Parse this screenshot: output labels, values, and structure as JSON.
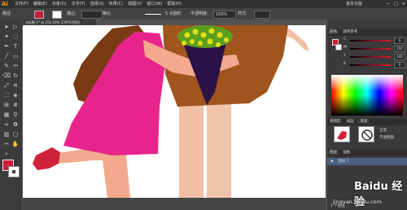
{
  "app": {
    "logo": "Ai"
  },
  "menubar": {
    "items": [
      "文件(F)",
      "编辑(E)",
      "对象(O)",
      "文字(T)",
      "选择(S)",
      "效果(C)",
      "视图(V)",
      "窗口(W)",
      "帮助(H)"
    ],
    "workspace": "基本功能",
    "window_controls": [
      "—",
      "□",
      "✕"
    ]
  },
  "controlbar": {
    "path_label": "路径",
    "stroke_label": "描边:",
    "stroke_value": "",
    "uniform_label": "等比",
    "brush_label": "5 点圆形",
    "opacity_label": "不透明度:",
    "opacity_value": "100%",
    "style_label": "样式:"
  },
  "document": {
    "tab_title": "未标题-1* @ 201.83% (CMYK/预览)"
  },
  "toolbar": {
    "tools": [
      "selection-arrow",
      "direct-select",
      "magic-wand",
      "lasso",
      "pen",
      "type",
      "line",
      "rectangle",
      "paintbrush",
      "pencil",
      "eraser",
      "rotate",
      "scale",
      "width",
      "free-transform",
      "shape-builder",
      "perspective",
      "mesh",
      "gradient",
      "eyedropper",
      "blend",
      "symbol-sprayer",
      "column-graph",
      "artboard",
      "slice",
      "hand",
      "zoom"
    ],
    "fill_color": "#d01f35",
    "stroke_color": "#ffffff"
  },
  "canvas": {
    "background": "#ffffff",
    "colors": {
      "dress": "#e8248c",
      "hair": "#7a3a14",
      "skin": "#f2a98d",
      "shirt": "#a0541e",
      "legs": "#f2bfa5",
      "shoe": "#d0203a",
      "cone": "#2a1246",
      "leaves": "#5c9e1f",
      "flowers": "#e0e01a"
    }
  },
  "panels": {
    "color_tabs": [
      "颜色",
      "颜色参考"
    ],
    "sliders": [
      {
        "label": "C",
        "value": "0"
      },
      {
        "label": "M",
        "value": "100"
      },
      {
        "label": "Y",
        "value": "100"
      },
      {
        "label": "K",
        "value": "0"
      }
    ],
    "appearance_tabs": [
      "透明度",
      "描边",
      "渐变"
    ],
    "blend_label": "正常",
    "opacity_label": "不透明度:",
    "opacity_value": "100%",
    "layers_tabs": [
      "图层",
      "画板"
    ],
    "layer_name": "图层 1",
    "layer_count": "1 个图层"
  },
  "watermark": {
    "text": "Baidu 经验",
    "url": "jingyan.baidu.com"
  }
}
